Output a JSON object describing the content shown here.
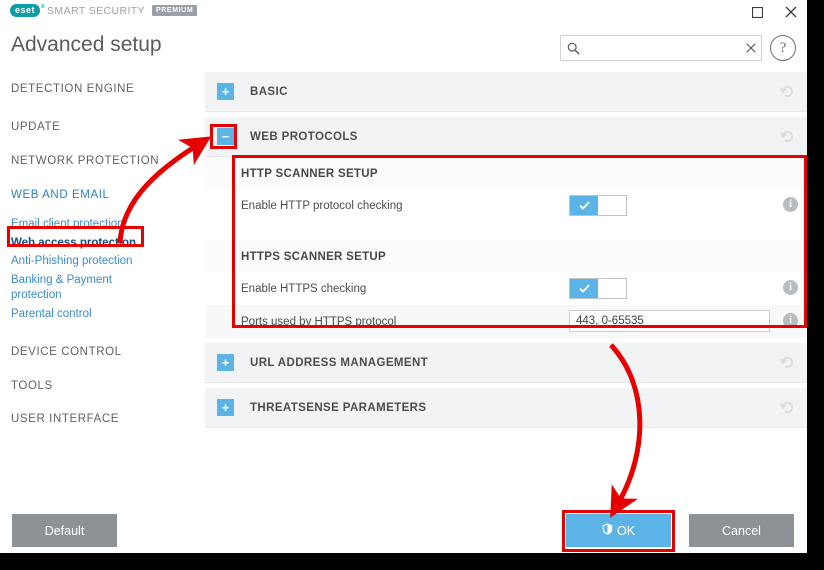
{
  "window": {
    "brand": "eset",
    "product_name": "SMART SECURITY",
    "edition_badge": "PREMIUM",
    "controls": {
      "maximize": "maximize-icon",
      "close": "close-icon"
    }
  },
  "header": {
    "title": "Advanced setup",
    "search": {
      "value": "",
      "placeholder": "",
      "icon": "search-icon",
      "clear_icon": "clear-icon"
    },
    "help_label": "?"
  },
  "sidebar": {
    "items": [
      {
        "label": "DETECTION ENGINE",
        "type": "top",
        "state": "normal"
      },
      {
        "label": "UPDATE",
        "type": "top",
        "state": "normal"
      },
      {
        "label": "NETWORK PROTECTION",
        "type": "top",
        "state": "normal"
      },
      {
        "label": "WEB AND EMAIL",
        "type": "top",
        "state": "active"
      },
      {
        "label": "Email client protection",
        "type": "sub",
        "state": "normal"
      },
      {
        "label": "Web access protection",
        "type": "sub",
        "state": "selected"
      },
      {
        "label": "Anti-Phishing protection",
        "type": "sub",
        "state": "normal"
      },
      {
        "label": "Banking & Payment protection",
        "type": "sub",
        "state": "normal"
      },
      {
        "label": "Parental control",
        "type": "sub",
        "state": "normal"
      },
      {
        "label": "DEVICE CONTROL",
        "type": "top",
        "state": "normal"
      },
      {
        "label": "TOOLS",
        "type": "top",
        "state": "normal"
      },
      {
        "label": "USER INTERFACE",
        "type": "top",
        "state": "normal"
      }
    ]
  },
  "content": {
    "sections": [
      {
        "label": "BASIC",
        "expander": "+",
        "expanded": false,
        "revert_icon": "revert-icon"
      },
      {
        "label": "WEB PROTOCOLS",
        "expander": "−",
        "expanded": true,
        "revert_icon": "revert-icon"
      },
      {
        "label": "URL ADDRESS MANAGEMENT",
        "expander": "+",
        "expanded": false,
        "revert_icon": "revert-icon"
      },
      {
        "label": "THREATSENSE PARAMETERS",
        "expander": "+",
        "expanded": false,
        "revert_icon": "revert-icon"
      }
    ],
    "web_protocols": {
      "groups": [
        {
          "title": "HTTP SCANNER SETUP",
          "rows": [
            {
              "label": "Enable HTTP protocol checking",
              "control": "toggle",
              "value": "on",
              "info_icon": "info-icon"
            }
          ]
        },
        {
          "title": "HTTPS SCANNER SETUP",
          "rows": [
            {
              "label": "Enable HTTPS checking",
              "control": "toggle",
              "value": "on",
              "info_icon": "info-icon"
            },
            {
              "label": "Ports used by HTTPS protocol",
              "control": "text",
              "value": "443, 0-65535",
              "info_icon": "info-icon"
            }
          ]
        }
      ]
    }
  },
  "footer": {
    "default_label": "Default",
    "ok_label": "OK",
    "ok_icon": "shield-icon",
    "cancel_label": "Cancel"
  },
  "annotations": {
    "accent_color": "#e60000",
    "highlight_boxes": [
      "sidebar-web-access-protection",
      "web-protocols-expander",
      "web-protocols-detail-panel",
      "ok-button"
    ],
    "arrows": [
      "arrow-to-web-protocols-expander",
      "arrow-to-ok-button"
    ]
  },
  "theme": {
    "accent_blue": "#5bb4e5",
    "link_blue": "#3a8ad0",
    "selected_blue": "#0e4c8a",
    "brand_teal": "#0b9da8",
    "gray_button": "#8d9296"
  }
}
